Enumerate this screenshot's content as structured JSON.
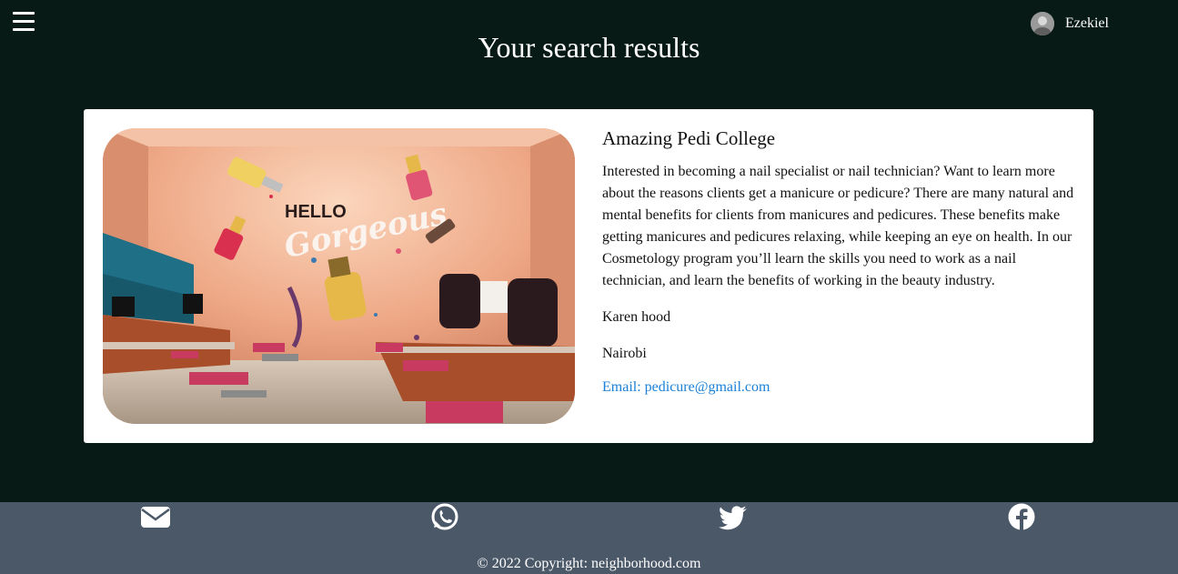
{
  "header": {
    "user_name": "Ezekiel",
    "page_title": "Your search results"
  },
  "result": {
    "image_text_line1": "HELLO",
    "image_text_line2": "Gorgeous",
    "title": "Amazing Pedi College",
    "description": "Interested in becoming a nail specialist or nail technician? Want to learn more about the reasons clients get a manicure or pedicure? There are many natural and mental benefits for clients from manicures and pedicures. These benefits make getting manicures and pedicures relaxing, while keeping an eye on health. In our Cosmetology program you’ll learn the skills you need to work as a nail technician, and learn the benefits of working in the beauty industry.",
    "owner": "Karen hood",
    "location": "Nairobi",
    "email_label": "Email: pedicure@gmail.com"
  },
  "footer": {
    "icons": [
      "envelope-icon",
      "whatsapp-icon",
      "twitter-icon",
      "facebook-icon"
    ],
    "copyright": "© 2022 Copyright: neighborhood.com"
  },
  "colors": {
    "background": "#071a15",
    "footer": "#4a5868",
    "link": "#1a7fd6"
  }
}
